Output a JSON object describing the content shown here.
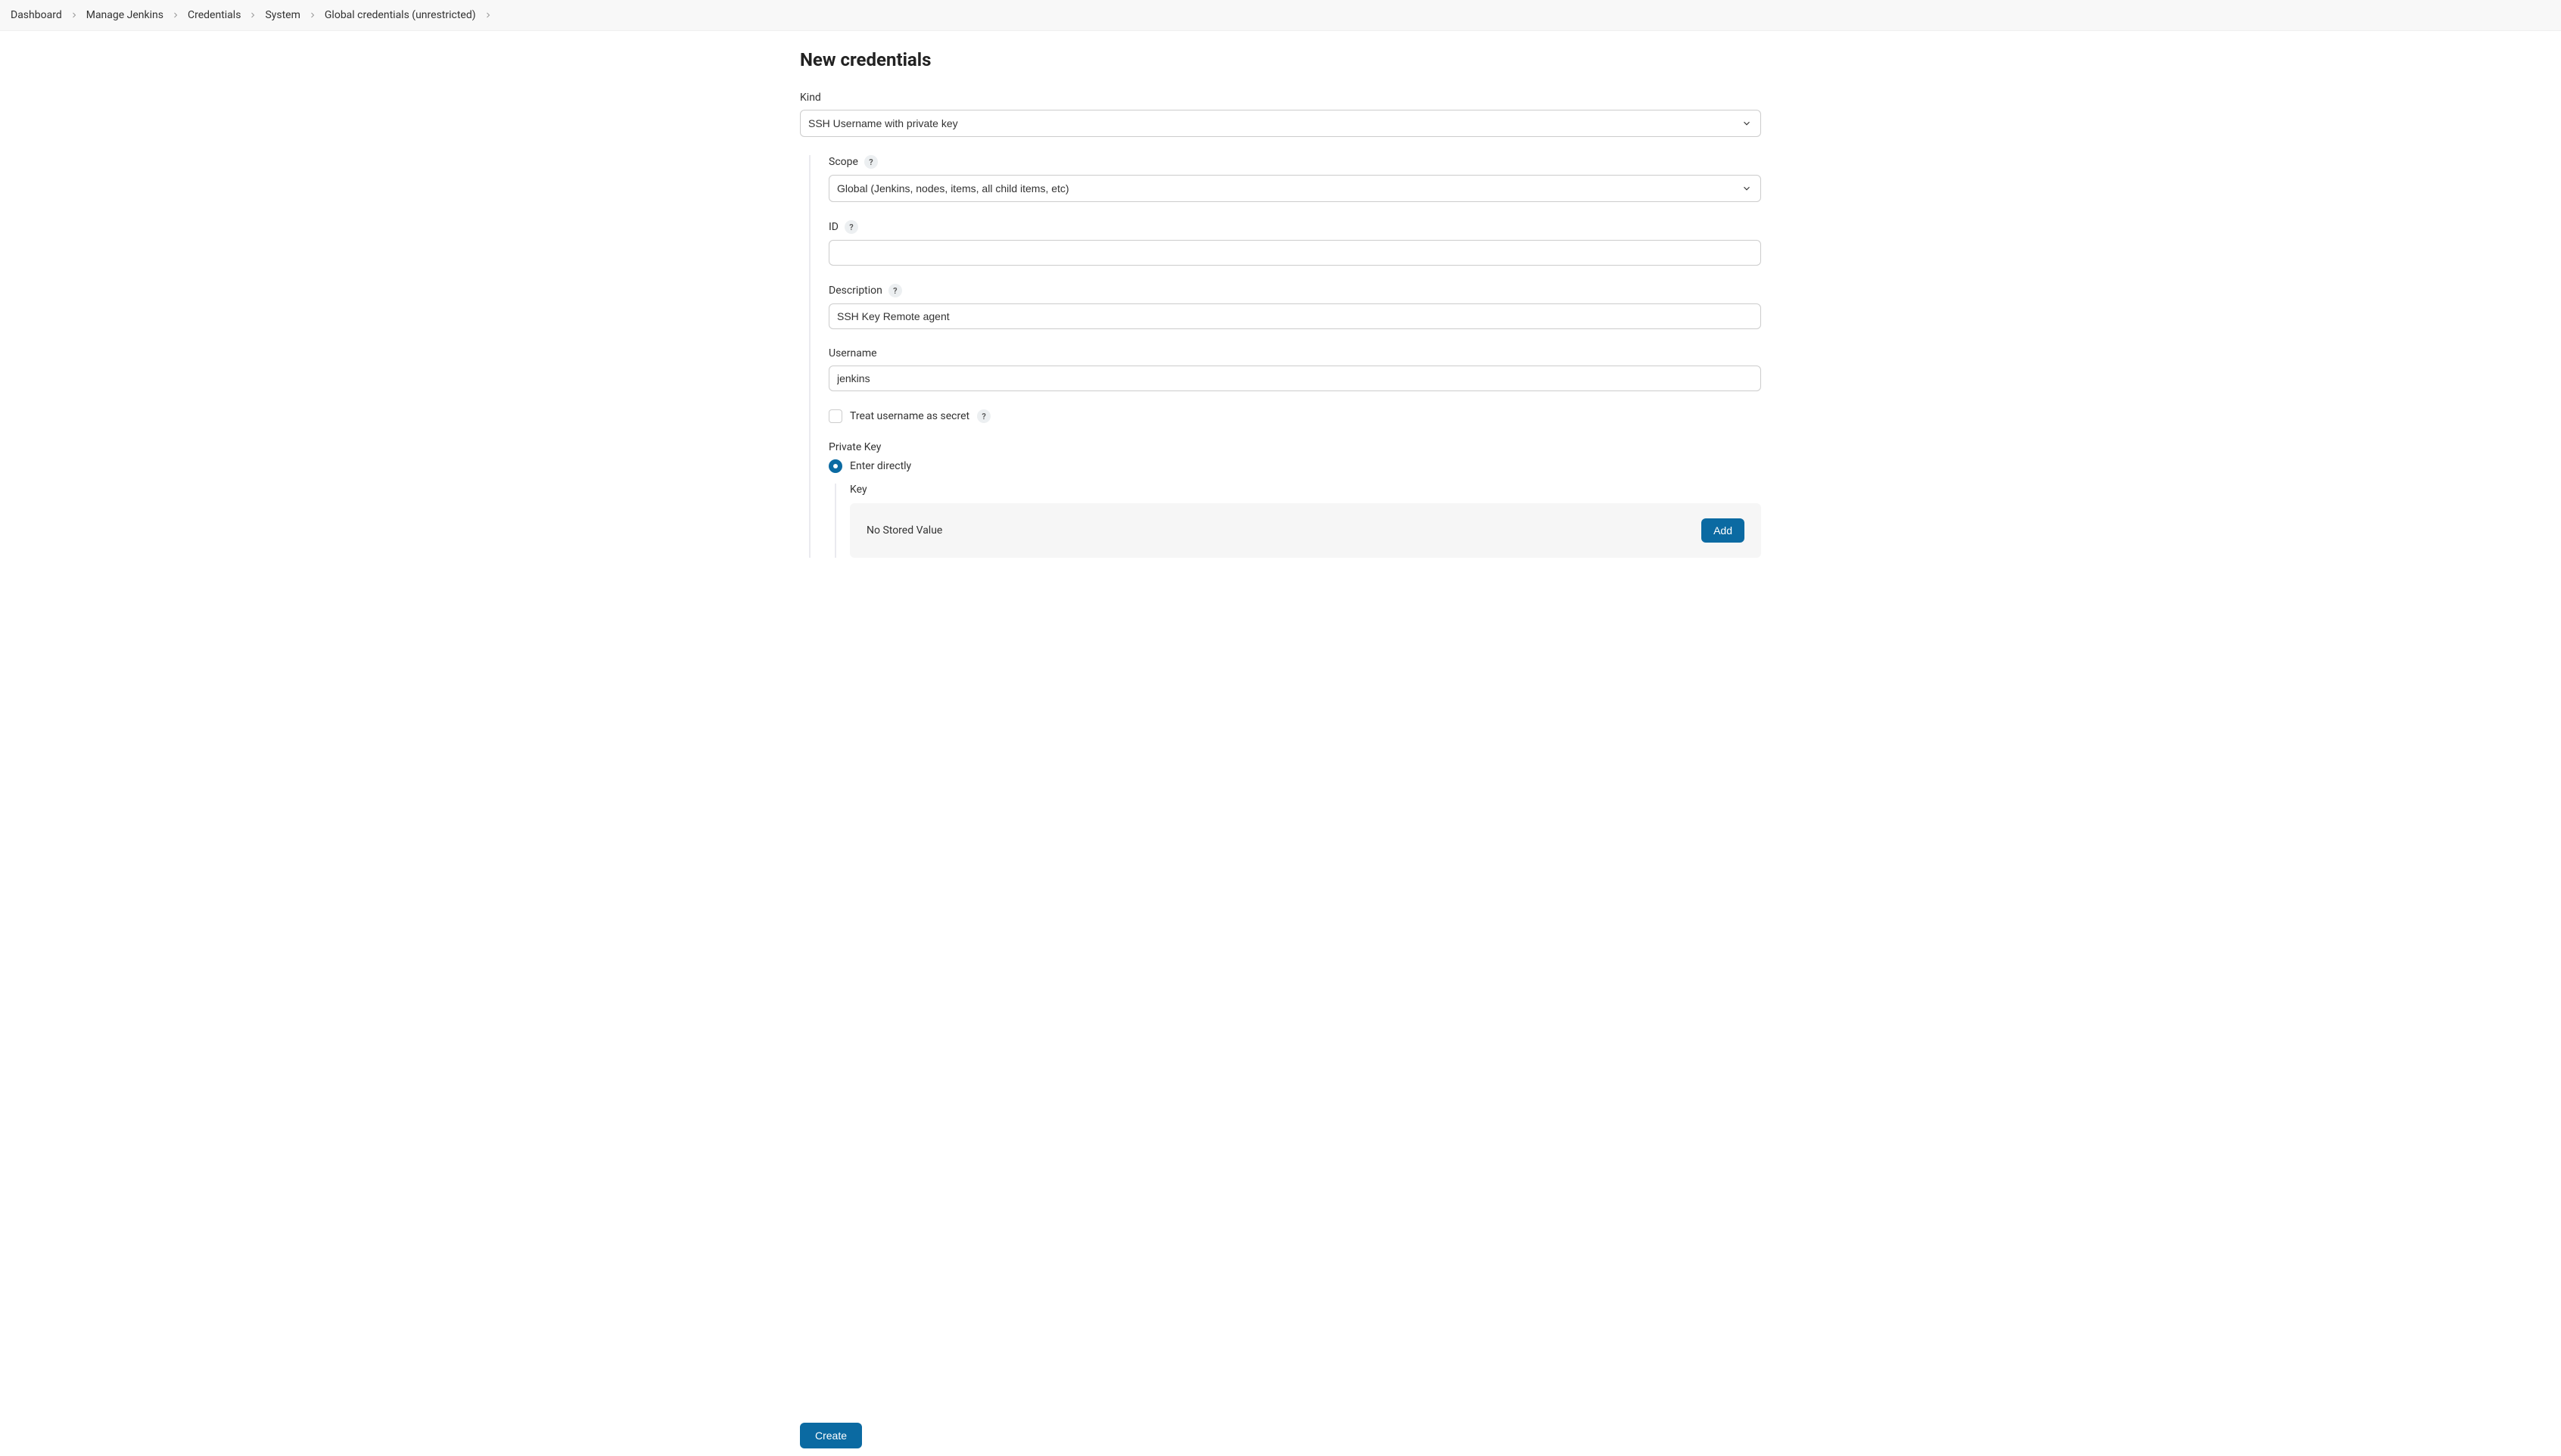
{
  "breadcrumbs": {
    "items": [
      {
        "label": "Dashboard"
      },
      {
        "label": "Manage Jenkins"
      },
      {
        "label": "Credentials"
      },
      {
        "label": "System"
      },
      {
        "label": "Global credentials (unrestricted)"
      }
    ]
  },
  "page": {
    "title": "New credentials"
  },
  "form": {
    "kind": {
      "label": "Kind",
      "value": "SSH Username with private key"
    },
    "scope": {
      "label": "Scope",
      "value": "Global (Jenkins, nodes, items, all child items, etc)"
    },
    "id": {
      "label": "ID",
      "value": ""
    },
    "description": {
      "label": "Description",
      "value": "SSH Key Remote agent"
    },
    "username": {
      "label": "Username",
      "value": "jenkins"
    },
    "treat_secret": {
      "label": "Treat username as secret"
    },
    "private_key": {
      "label": "Private Key",
      "enter_directly": "Enter directly",
      "key_label": "Key",
      "key_status": "No Stored Value",
      "add_label": "Add"
    },
    "create_label": "Create",
    "help_char": "?"
  }
}
